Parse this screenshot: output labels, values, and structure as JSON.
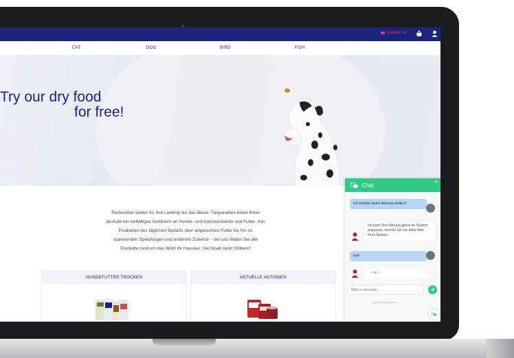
{
  "topbar": {
    "contact_label": "Contact us",
    "brand_color": "#1a237e",
    "accent_color": "#e53965"
  },
  "categories": [
    "CAT",
    "DOG",
    "BIRD",
    "FISH"
  ],
  "hero": {
    "line1": "Try our dry food",
    "line2": "for free!"
  },
  "intro": {
    "lines": [
      "Tierbesitzer wollen für ihre Liebling nur das Beste. Tierparadies bietet Ihnen",
      "deshalb ein vielfältiges Sortiment an Hunde- und Katzenzubehör und Futter. Von",
      "Produkten des täglichen Bedarfs über artgerechtes Futter bis hin zu",
      "spannenden Spielzeugen und anderem Zubehör – bei uns finden Sie alle",
      "Produkte rund um das Wohl Ihr Haustier. Viel Spaß beim Stöbern!"
    ]
  },
  "cards": [
    {
      "title": "HUNDEFUTTER TROCKEN"
    },
    {
      "title": "AKTUELLE AKTIONEN"
    }
  ],
  "chat": {
    "title": "Chat",
    "accent_color": "#2ecc87",
    "messages": [
      {
        "from": "user",
        "text": "Ich möchte meine Adresse ändern!"
      },
      {
        "from": "bot",
        "text": "Ich kann Ihre Adresse gerne im System anpassen, nennen Sie mir dafür bitte Ihren Namen."
      },
      {
        "from": "user",
        "text": "Karl"
      }
    ],
    "input_placeholder": "Write a message...",
    "powered_by": "powered by parlamind"
  },
  "icons": {
    "basket": "basket-icon",
    "user": "user-icon",
    "mail": "envelope-icon",
    "chat": "chat-icon",
    "send": "send-icon",
    "close": "close-icon"
  }
}
